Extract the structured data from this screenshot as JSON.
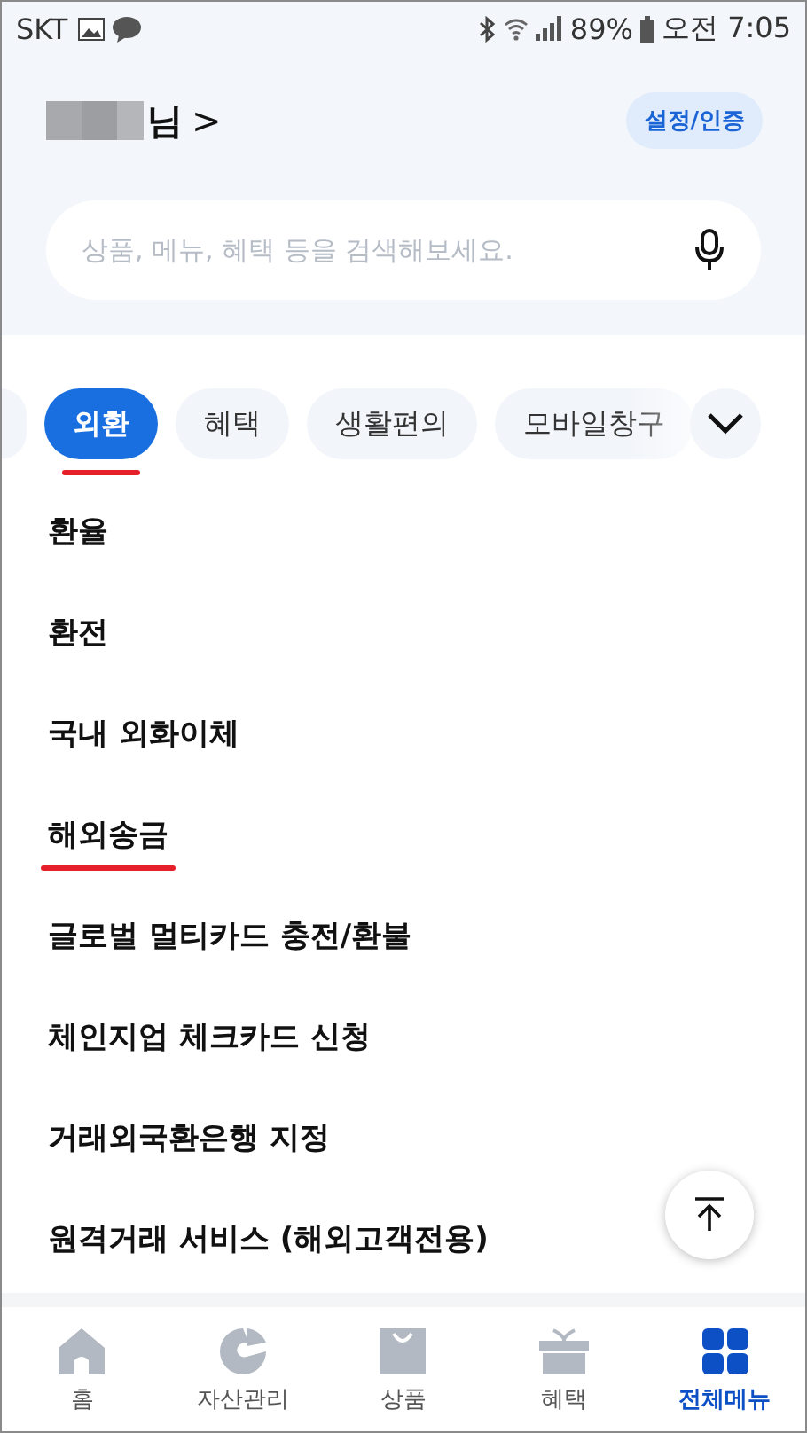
{
  "status_bar": {
    "carrier": "SKT",
    "battery": "89%",
    "time": "오전 7:05"
  },
  "header": {
    "greeting_suffix": "님",
    "chevron": ">",
    "auth_button": "설정/인증"
  },
  "search": {
    "placeholder": "상품, 메뉴, 혜택 등을 검색해보세요."
  },
  "categories": [
    {
      "label": "외환",
      "selected": true,
      "marked": true
    },
    {
      "label": "혜택",
      "selected": false,
      "marked": false
    },
    {
      "label": "생활편의",
      "selected": false,
      "marked": false
    },
    {
      "label": "모바일창구",
      "selected": false,
      "marked": false
    }
  ],
  "menu_items": [
    {
      "label": "환율",
      "marked": false
    },
    {
      "label": "환전",
      "marked": false
    },
    {
      "label": "국내 외화이체",
      "marked": false
    },
    {
      "label": "해외송금",
      "marked": true
    },
    {
      "label": "글로벌 멀티카드 충전/환불",
      "marked": false
    },
    {
      "label": "체인지업 체크카드 신청",
      "marked": false
    },
    {
      "label": "거래외국환은행 지정",
      "marked": false
    },
    {
      "label": "원격거래 서비스 (해외고객전용)",
      "marked": false
    }
  ],
  "bottom_nav": [
    {
      "label": "홈",
      "kind": "home",
      "selected": false
    },
    {
      "label": "자산관리",
      "kind": "assets",
      "selected": false
    },
    {
      "label": "상품",
      "kind": "products",
      "selected": false
    },
    {
      "label": "혜택",
      "kind": "benefits",
      "selected": false
    },
    {
      "label": "전체메뉴",
      "kind": "menu",
      "selected": true
    }
  ]
}
